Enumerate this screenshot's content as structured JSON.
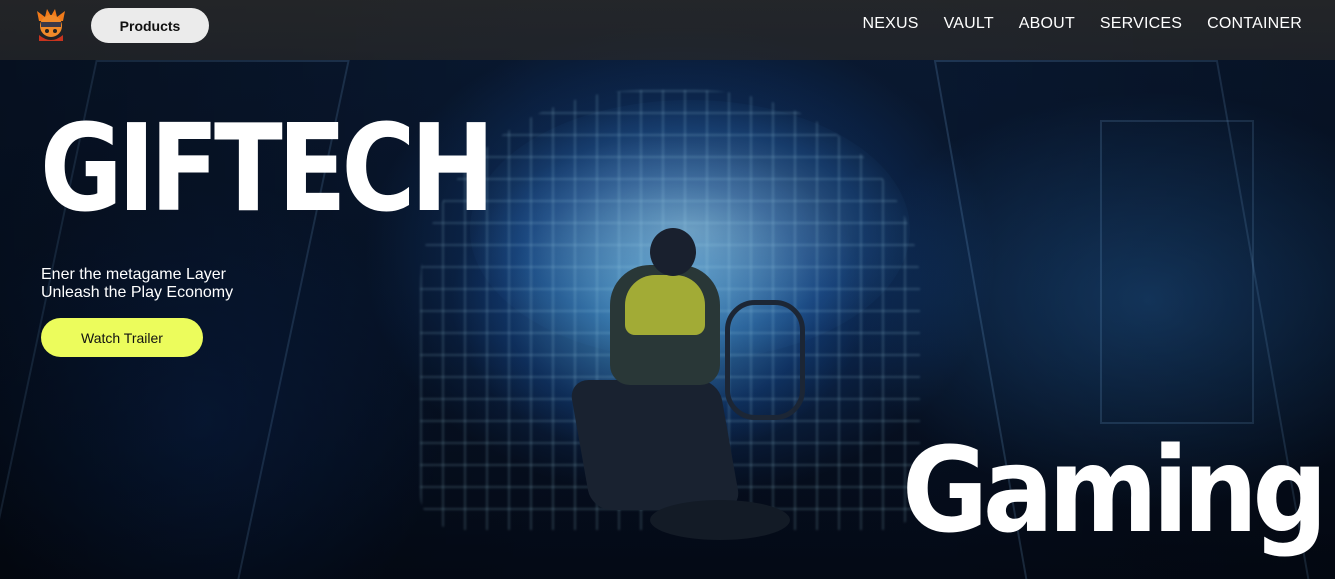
{
  "header": {
    "products_label": "Products",
    "nav": [
      "NEXUS",
      "VAULT",
      "ABOUT",
      "SERVICES",
      "CONTAINER"
    ]
  },
  "hero": {
    "title": "GIFTECH",
    "tagline_line1": "Ener the metagame Layer",
    "tagline_line2": "Unleash the Play Economy",
    "cta_label": "Watch Trailer",
    "big_word": "Gaming"
  },
  "colors": {
    "cta_background": "#ecfc5c",
    "products_background": "#ebebeb",
    "header_background": "#2a2a2a"
  },
  "icons": {
    "logo": "ninja-mascot-logo"
  }
}
